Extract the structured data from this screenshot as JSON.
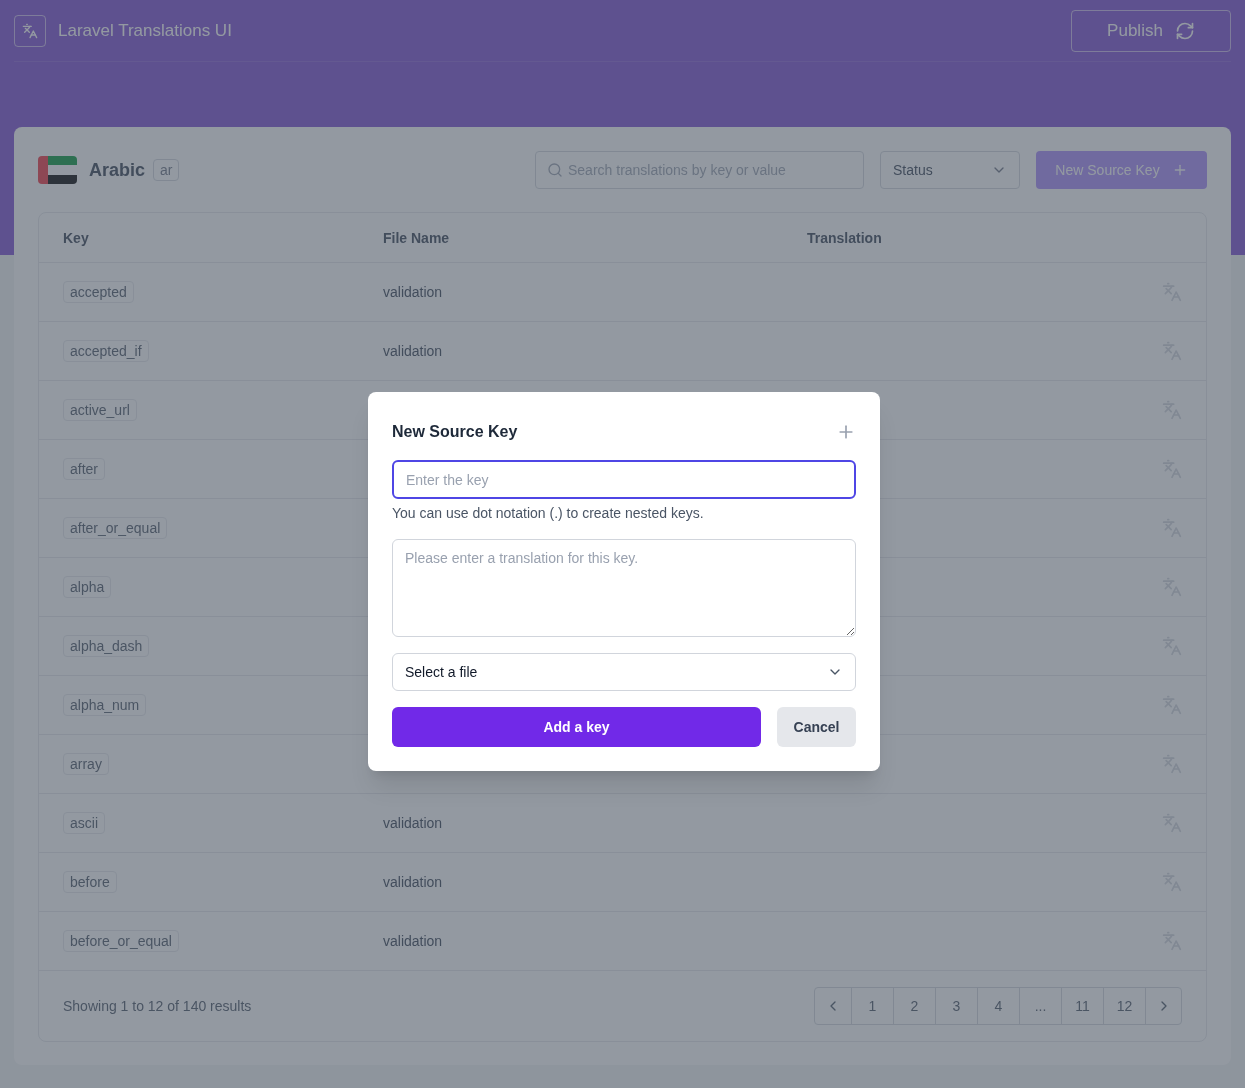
{
  "app": {
    "title": "Laravel Translations UI",
    "publish_button": "Publish"
  },
  "language": {
    "name": "Arabic",
    "code": "ar"
  },
  "toolbar": {
    "search_placeholder": "Search translations by key or value",
    "status_select": "Status",
    "new_key_button": "New Source Key"
  },
  "table": {
    "columns": [
      "Key",
      "File Name",
      "Translation"
    ],
    "rows": [
      {
        "key": "accepted",
        "file_name": "validation"
      },
      {
        "key": "accepted_if",
        "file_name": "validation"
      },
      {
        "key": "active_url"
      },
      {
        "key": "after"
      },
      {
        "key": "after_or_equal"
      },
      {
        "key": "alpha"
      },
      {
        "key": "alpha_dash"
      },
      {
        "key": "alpha_num"
      },
      {
        "key": "array"
      },
      {
        "key": "ascii",
        "file_name": "validation"
      },
      {
        "key": "before",
        "file_name": "validation"
      },
      {
        "key": "before_or_equal",
        "file_name": "validation"
      }
    ]
  },
  "footer": {
    "summary": "Showing 1 to 12 of 140 results",
    "pages": [
      "1",
      "2",
      "3",
      "4",
      "...",
      "11",
      "12"
    ]
  },
  "modal": {
    "title": "New Source Key",
    "key_placeholder": "Enter the key",
    "hint": "You can use dot notation (.) to create nested keys.",
    "translation_placeholder": "Please enter a translation for this key.",
    "file_select": "Select a file",
    "submit_button": "Add a key",
    "cancel_button": "Cancel"
  }
}
